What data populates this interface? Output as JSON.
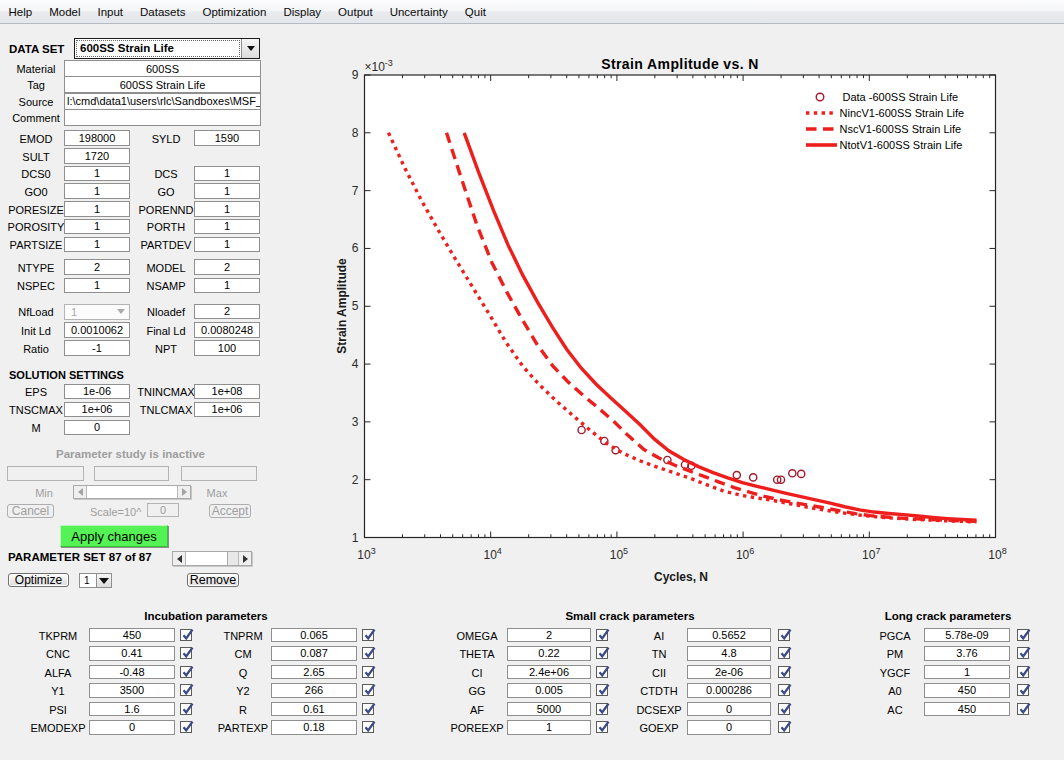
{
  "menu": {
    "items": [
      "Help",
      "Model",
      "Input",
      "Datasets",
      "Optimization",
      "Display",
      "Output",
      "Uncertainty",
      "Quit"
    ]
  },
  "dataset": {
    "label": "DATA SET",
    "value": "600SS Strain Life"
  },
  "info_rows": [
    {
      "label": "Material",
      "value": "600SS",
      "align": "center"
    },
    {
      "label": "Tag",
      "value": "600SS Strain Life",
      "align": "center"
    },
    {
      "label": "Source",
      "value": "l:\\cmd\\data1\\users\\rlc\\Sandboxes\\MSF_",
      "align": "left"
    },
    {
      "label": "Comment",
      "value": "",
      "align": "center"
    }
  ],
  "param_rows": [
    {
      "l": "EMOD",
      "lv": "198000",
      "r": "SYLD",
      "rv": "1590"
    },
    {
      "l": "SULT",
      "lv": "1720"
    },
    {
      "l": "DCS0",
      "lv": "1",
      "r": "DCS",
      "rv": "1"
    },
    {
      "l": "GO0",
      "lv": "1",
      "r": "GO",
      "rv": "1"
    },
    {
      "l": "PORESIZE",
      "lv": "1",
      "r": "PORENND",
      "rv": "1"
    },
    {
      "l": "POROSITY",
      "lv": "1",
      "r": "PORTH",
      "rv": "1"
    },
    {
      "l": "PARTSIZE",
      "lv": "1",
      "r": "PARTDEV",
      "rv": "1"
    },
    {
      "l": "NTYPE",
      "lv": "2",
      "r": "MODEL",
      "rv": "2"
    },
    {
      "l": "NSPEC",
      "lv": "1",
      "r": "NSAMP",
      "rv": "1"
    },
    {
      "l": "NfLoad",
      "lv": "1",
      "r": "Nloadef",
      "rv": "2",
      "left_type": "dropdown_disabled"
    },
    {
      "l": "Init Ld",
      "lv": "0.0010062",
      "r": "Final Ld",
      "rv": "0.0080248"
    },
    {
      "l": "Ratio",
      "lv": "-1",
      "r": "NPT",
      "rv": "100"
    },
    {
      "l": "EPS",
      "lv": "1e-06",
      "r": "TNINCMAX",
      "rv": "1e+08"
    },
    {
      "l": "TNSCMAX",
      "lv": "1e+06",
      "r": "TNLCMAX",
      "rv": "1e+06"
    },
    {
      "l": "M",
      "lv": "0"
    }
  ],
  "solution_heading": "SOLUTION SETTINGS",
  "param_study": {
    "status": "Parameter study is inactive",
    "min_label": "Min",
    "max_label": "Max",
    "cancel": "Cancel",
    "scale_label": "Scale=10^",
    "scale_value": "0",
    "accept": "Accept",
    "apply": "Apply changes",
    "set_label": "PARAMETER SET 87 of 87",
    "optimize": "Optimize",
    "optimize_count": "1",
    "remove": "Remove"
  },
  "bottom_panels": [
    {
      "title": "Incubation parameters",
      "rows": [
        [
          "TKPRM",
          "450",
          "TNPRM",
          "0.065"
        ],
        [
          "CNC",
          "0.41",
          "CM",
          "0.087"
        ],
        [
          "ALFA",
          "-0.48",
          "Q",
          "2.65"
        ],
        [
          "Y1",
          "3500",
          "Y2",
          "266"
        ],
        [
          "PSI",
          "1.6",
          "R",
          "0.61"
        ],
        [
          "EMODEXP",
          "0",
          "PARTEXP",
          "0.18"
        ]
      ],
      "all_checked": true
    },
    {
      "title": "Small crack parameters",
      "rows": [
        [
          "OMEGA",
          "2",
          "AI",
          "0.5652"
        ],
        [
          "THETA",
          "0.22",
          "TN",
          "4.8"
        ],
        [
          "CI",
          "2.4e+06",
          "CII",
          "2e-06"
        ],
        [
          "GG",
          "0.005",
          "CTDTH",
          "0.000286"
        ],
        [
          "AF",
          "5000",
          "DCSEXP",
          "0"
        ],
        [
          "POREEXP",
          "1",
          "GOEXP",
          "0"
        ]
      ],
      "all_checked": true
    },
    {
      "title": "Long crack parameters",
      "rows": [
        [
          "PGCA",
          "5.78e-09"
        ],
        [
          "PM",
          "3.76"
        ],
        [
          "YGCF",
          "1"
        ],
        [
          "A0",
          "450"
        ],
        [
          "AC",
          "450"
        ]
      ],
      "all_checked": true
    }
  ],
  "chart_data": {
    "type": "line",
    "title": "Strain Amplitude vs. N",
    "xlabel": "Cycles, N",
    "ylabel": "Strain Amplitude",
    "y_multiplier": {
      "prefix": "×10",
      "exponent": "-3"
    },
    "x_axis": {
      "scale": "log10",
      "min": 1000,
      "max": 100000000,
      "tick_decades": [
        3,
        4,
        5,
        6,
        7,
        8
      ],
      "minor_ticks": true
    },
    "y_axis": {
      "min_milli": 1,
      "max_milli": 9,
      "ticks_milli": [
        1,
        2,
        3,
        4,
        5,
        6,
        7,
        8,
        9
      ],
      "units": "strain (1e-3)"
    },
    "legend": {
      "position": "northeast",
      "frame": false
    },
    "colors": {
      "line_red": "#ed1e1c",
      "marker_red": "#a5182a"
    },
    "series": [
      {
        "name": "Data -600SS Strain Life",
        "type": "scatter",
        "marker": "circle",
        "color": "#a5182a",
        "points_logN_eps3": [
          [
            4.72,
            2.86
          ],
          [
            4.9,
            2.67
          ],
          [
            4.99,
            2.51
          ],
          [
            5.4,
            2.34
          ],
          [
            5.54,
            2.26
          ],
          [
            5.59,
            2.24
          ],
          [
            5.95,
            2.08
          ],
          [
            6.08,
            2.04
          ],
          [
            6.27,
            2.0
          ],
          [
            6.3,
            2.0
          ],
          [
            6.39,
            2.11
          ],
          [
            6.46,
            2.1
          ]
        ]
      },
      {
        "name": "NincV1-600SS Strain Life",
        "type": "line",
        "linestyle": "dotted",
        "color": "#ed1e1c",
        "linewidth": 3.4,
        "points_logN_eps3": [
          [
            3.19,
            8.0
          ],
          [
            3.323,
            7.376
          ],
          [
            3.456,
            6.811
          ],
          [
            3.589,
            6.299
          ],
          [
            3.723,
            5.807
          ],
          [
            3.856,
            5.331
          ],
          [
            3.989,
            4.861
          ],
          [
            4.122,
            4.373
          ],
          [
            4.255,
            3.96
          ],
          [
            4.388,
            3.637
          ],
          [
            4.521,
            3.358
          ],
          [
            4.655,
            3.103
          ],
          [
            4.788,
            2.855
          ],
          [
            4.921,
            2.623
          ],
          [
            5.054,
            2.451
          ],
          [
            5.187,
            2.323
          ],
          [
            5.32,
            2.216
          ],
          [
            5.453,
            2.119
          ],
          [
            5.587,
            2.019
          ],
          [
            5.72,
            1.905
          ],
          [
            5.853,
            1.798
          ],
          [
            5.986,
            1.73
          ],
          [
            6.119,
            1.681
          ],
          [
            6.252,
            1.635
          ],
          [
            6.385,
            1.579
          ],
          [
            6.519,
            1.521
          ],
          [
            6.652,
            1.472
          ],
          [
            6.785,
            1.428
          ],
          [
            6.918,
            1.389
          ],
          [
            7.051,
            1.36
          ],
          [
            7.184,
            1.336
          ],
          [
            7.317,
            1.318
          ],
          [
            7.451,
            1.304
          ],
          [
            7.584,
            1.291
          ],
          [
            7.717,
            1.28
          ],
          [
            7.85,
            1.27
          ]
        ]
      },
      {
        "name": "NscV1-600SS Strain Life",
        "type": "line",
        "linestyle": "dashed",
        "color": "#ed1e1c",
        "linewidth": 3.4,
        "points_logN_eps3": [
          [
            3.65,
            8.0
          ],
          [
            3.77,
            7.195
          ],
          [
            3.89,
            6.41
          ],
          [
            4.01,
            5.753
          ],
          [
            4.13,
            5.235
          ],
          [
            4.25,
            4.769
          ],
          [
            4.37,
            4.332
          ],
          [
            4.49,
            3.974
          ],
          [
            4.61,
            3.698
          ],
          [
            4.73,
            3.463
          ],
          [
            4.85,
            3.245
          ],
          [
            4.97,
            3.02
          ],
          [
            5.09,
            2.762
          ],
          [
            5.21,
            2.529
          ],
          [
            5.33,
            2.378
          ],
          [
            5.45,
            2.258
          ],
          [
            5.57,
            2.154
          ],
          [
            5.69,
            2.058
          ],
          [
            5.81,
            1.958
          ],
          [
            5.93,
            1.864
          ],
          [
            6.05,
            1.784
          ],
          [
            6.17,
            1.712
          ],
          [
            6.29,
            1.65
          ],
          [
            6.41,
            1.6
          ],
          [
            6.53,
            1.556
          ],
          [
            6.65,
            1.51
          ],
          [
            6.77,
            1.46
          ],
          [
            6.89,
            1.413
          ],
          [
            7.01,
            1.378
          ],
          [
            7.13,
            1.355
          ],
          [
            7.25,
            1.336
          ],
          [
            7.37,
            1.322
          ],
          [
            7.49,
            1.31
          ],
          [
            7.61,
            1.299
          ],
          [
            7.73,
            1.289
          ],
          [
            7.85,
            1.28
          ]
        ]
      },
      {
        "name": "NtotV1-600SS Strain Life",
        "type": "line",
        "linestyle": "solid",
        "color": "#ed1e1c",
        "linewidth": 3.4,
        "points_logN_eps3": [
          [
            3.79,
            8.0
          ],
          [
            3.906,
            7.306
          ],
          [
            4.022,
            6.657
          ],
          [
            4.138,
            6.057
          ],
          [
            4.254,
            5.538
          ],
          [
            4.37,
            5.075
          ],
          [
            4.486,
            4.648
          ],
          [
            4.602,
            4.256
          ],
          [
            4.718,
            3.928
          ],
          [
            4.834,
            3.656
          ],
          [
            4.95,
            3.416
          ],
          [
            5.066,
            3.188
          ],
          [
            5.182,
            2.954
          ],
          [
            5.298,
            2.701
          ],
          [
            5.414,
            2.495
          ],
          [
            5.53,
            2.349
          ],
          [
            5.646,
            2.226
          ],
          [
            5.762,
            2.121
          ],
          [
            5.878,
            2.03
          ],
          [
            5.994,
            1.951
          ],
          [
            6.11,
            1.884
          ],
          [
            6.226,
            1.823
          ],
          [
            6.342,
            1.763
          ],
          [
            6.458,
            1.707
          ],
          [
            6.574,
            1.652
          ],
          [
            6.69,
            1.594
          ],
          [
            6.806,
            1.532
          ],
          [
            6.922,
            1.477
          ],
          [
            7.038,
            1.44
          ],
          [
            7.154,
            1.416
          ],
          [
            7.27,
            1.396
          ],
          [
            7.386,
            1.372
          ],
          [
            7.502,
            1.347
          ],
          [
            7.618,
            1.327
          ],
          [
            7.734,
            1.312
          ],
          [
            7.85,
            1.3
          ]
        ]
      }
    ]
  }
}
